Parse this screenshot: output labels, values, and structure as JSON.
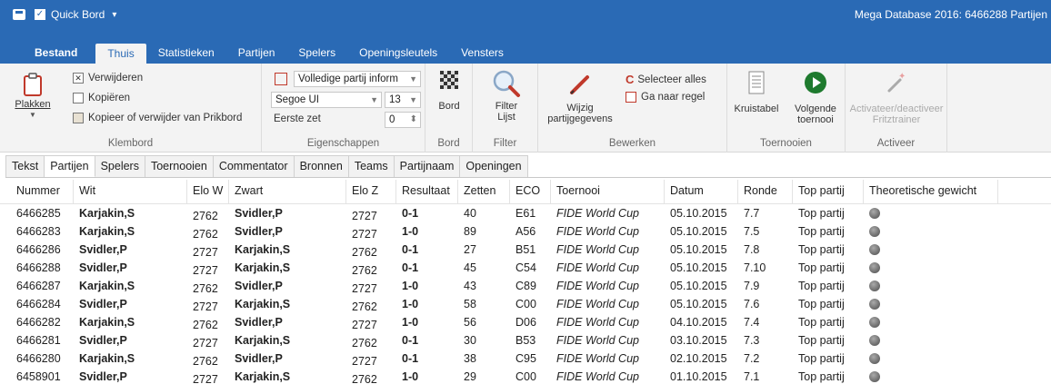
{
  "qat": {
    "title": "Quick Bord"
  },
  "app_title": "Mega Database 2016:  6466288 Partijen",
  "menu_tabs": [
    {
      "label": "Bestand"
    },
    {
      "label": "Thuis"
    },
    {
      "label": "Statistieken"
    },
    {
      "label": "Partijen"
    },
    {
      "label": "Spelers"
    },
    {
      "label": "Openingsleutels"
    },
    {
      "label": "Vensters"
    }
  ],
  "ribbon": {
    "klembord": {
      "label": "Klembord",
      "paste": "Plakken",
      "delete": "Verwijderen",
      "copy": "Kopiëren",
      "copy_delete_clipboard": "Kopieer of verwijder van Prikbord"
    },
    "eigenschappen": {
      "label": "Eigenschappen",
      "info_select": "Volledige partij inform",
      "font_select": "Segoe UI",
      "size_select": "13",
      "first_move_label": "Eerste zet",
      "first_move_value": "0"
    },
    "bord": {
      "label": "Bord",
      "button": "Bord"
    },
    "filter": {
      "label": "Filter",
      "button_line1": "Filter",
      "button_line2": "Lijst"
    },
    "bewerken": {
      "label": "Bewerken",
      "edit_line1": "Wijzig",
      "edit_line2": "partijgegevens",
      "select_all": "Selecteer alles",
      "goto_line": "Ga naar regel"
    },
    "toernooien": {
      "label": "Toernooien",
      "crosstable": "Kruistabel",
      "next_line1": "Volgende",
      "next_line2": "toernooi"
    },
    "activeer": {
      "label": "Activeer",
      "toggle_line1": "Activateer/deactiveer",
      "toggle_line2": "Fritztrainer"
    }
  },
  "sub_tabs": [
    {
      "label": "Tekst"
    },
    {
      "label": "Partijen"
    },
    {
      "label": "Spelers"
    },
    {
      "label": "Toernooien"
    },
    {
      "label": "Commentator"
    },
    {
      "label": "Bronnen"
    },
    {
      "label": "Teams"
    },
    {
      "label": "Partijnaam"
    },
    {
      "label": "Openingen"
    }
  ],
  "table": {
    "columns": [
      "Nummer",
      "Wit",
      "Elo W",
      "Zwart",
      "Elo Z",
      "Resultaat",
      "Zetten",
      "ECO",
      "Toernooi",
      "Datum",
      "Ronde",
      "Top partij",
      "Theoretische gewicht"
    ],
    "rows": [
      {
        "nummer": "6466285",
        "wit": "Karjakin,S",
        "elow": "2762",
        "zwart": "Svidler,P",
        "eloz": "2727",
        "res": "0-1",
        "zetten": "40",
        "eco": "E61",
        "toernooi": "FIDE World Cup",
        "datum": "05.10.2015",
        "ronde": "7.7",
        "top": "Top partij"
      },
      {
        "nummer": "6466283",
        "wit": "Karjakin,S",
        "elow": "2762",
        "zwart": "Svidler,P",
        "eloz": "2727",
        "res": "1-0",
        "zetten": "89",
        "eco": "A56",
        "toernooi": "FIDE World Cup",
        "datum": "05.10.2015",
        "ronde": "7.5",
        "top": "Top partij"
      },
      {
        "nummer": "6466286",
        "wit": "Svidler,P",
        "elow": "2727",
        "zwart": "Karjakin,S",
        "eloz": "2762",
        "res": "0-1",
        "zetten": "27",
        "eco": "B51",
        "toernooi": "FIDE World Cup",
        "datum": "05.10.2015",
        "ronde": "7.8",
        "top": "Top partij"
      },
      {
        "nummer": "6466288",
        "wit": "Svidler,P",
        "elow": "2727",
        "zwart": "Karjakin,S",
        "eloz": "2762",
        "res": "0-1",
        "zetten": "45",
        "eco": "C54",
        "toernooi": "FIDE World Cup",
        "datum": "05.10.2015",
        "ronde": "7.10",
        "top": "Top partij"
      },
      {
        "nummer": "6466287",
        "wit": "Karjakin,S",
        "elow": "2762",
        "zwart": "Svidler,P",
        "eloz": "2727",
        "res": "1-0",
        "zetten": "43",
        "eco": "C89",
        "toernooi": "FIDE World Cup",
        "datum": "05.10.2015",
        "ronde": "7.9",
        "top": "Top partij"
      },
      {
        "nummer": "6466284",
        "wit": "Svidler,P",
        "elow": "2727",
        "zwart": "Karjakin,S",
        "eloz": "2762",
        "res": "1-0",
        "zetten": "58",
        "eco": "C00",
        "toernooi": "FIDE World Cup",
        "datum": "05.10.2015",
        "ronde": "7.6",
        "top": "Top partij"
      },
      {
        "nummer": "6466282",
        "wit": "Karjakin,S",
        "elow": "2762",
        "zwart": "Svidler,P",
        "eloz": "2727",
        "res": "1-0",
        "zetten": "56",
        "eco": "D06",
        "toernooi": "FIDE World Cup",
        "datum": "04.10.2015",
        "ronde": "7.4",
        "top": "Top partij"
      },
      {
        "nummer": "6466281",
        "wit": "Svidler,P",
        "elow": "2727",
        "zwart": "Karjakin,S",
        "eloz": "2762",
        "res": "0-1",
        "zetten": "30",
        "eco": "B53",
        "toernooi": "FIDE World Cup",
        "datum": "03.10.2015",
        "ronde": "7.3",
        "top": "Top partij"
      },
      {
        "nummer": "6466280",
        "wit": "Karjakin,S",
        "elow": "2762",
        "zwart": "Svidler,P",
        "eloz": "2727",
        "res": "0-1",
        "zetten": "38",
        "eco": "C95",
        "toernooi": "FIDE World Cup",
        "datum": "02.10.2015",
        "ronde": "7.2",
        "top": "Top partij"
      },
      {
        "nummer": "6458901",
        "wit": "Svidler,P",
        "elow": "2727",
        "zwart": "Karjakin,S",
        "eloz": "2762",
        "res": "1-0",
        "zetten": "29",
        "eco": "C00",
        "toernooi": "FIDE World Cup",
        "datum": "01.10.2015",
        "ronde": "7.1",
        "top": "Top partij"
      }
    ]
  },
  "colors": {
    "accent": "#2a6ab5",
    "ribbon_bg": "#f3f3f3"
  }
}
